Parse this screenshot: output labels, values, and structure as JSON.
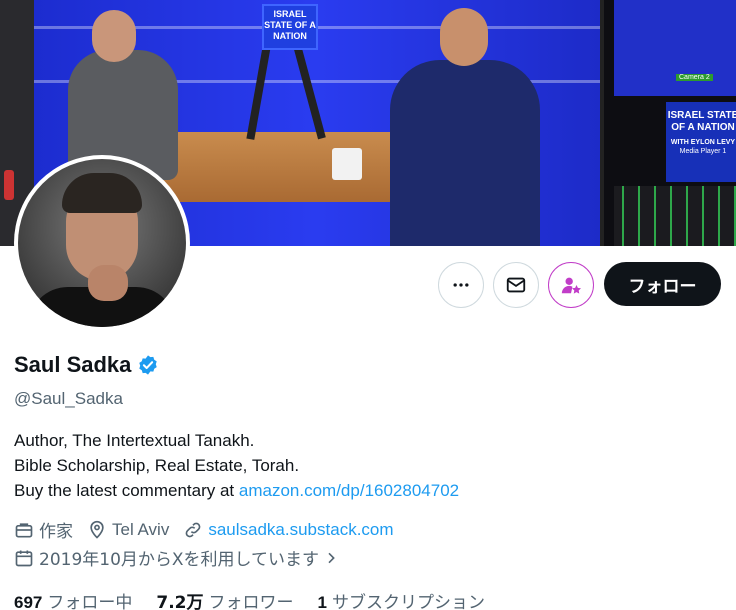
{
  "banner": {
    "sign_text": "ISRAEL STATE OF A NATION",
    "monitor_text": "ISRAEL STATE OF A NATION",
    "monitor_subtext": "WITH EYLON LEVY",
    "monitor_caption": "Media Player 1",
    "camera_label": "Camera 2"
  },
  "actions": {
    "more_icon": "more-icon",
    "message_icon": "envelope-icon",
    "subscribe_icon": "subscribe-star-icon",
    "follow_label": "フォロー"
  },
  "profile": {
    "display_name": "Saul Sadka",
    "handle": "@Saul_Sadka",
    "bio_line1": "Author, The Intertextual Tanakh.",
    "bio_line2": "Bible Scholarship, Real Estate, Torah.",
    "bio_line3_prefix": "Buy the latest commentary at",
    "bio_link": "amazon.com/dp/1602804702",
    "category": "作家",
    "location": "Tel Aviv",
    "website": "saulsadka.substack.com",
    "joined": "2019年10月からXを利用しています"
  },
  "stats": {
    "following_count": "697",
    "following_label": "フォロー中",
    "followers_count": "7.2万",
    "followers_label": "フォロワー",
    "subscriptions_count": "1",
    "subscriptions_label": "サブスクリプション"
  },
  "colors": {
    "accent": "#1d9bf0",
    "verified": "#1d9bf0",
    "subscribe": "#c13dc8",
    "text_secondary": "#536471"
  }
}
